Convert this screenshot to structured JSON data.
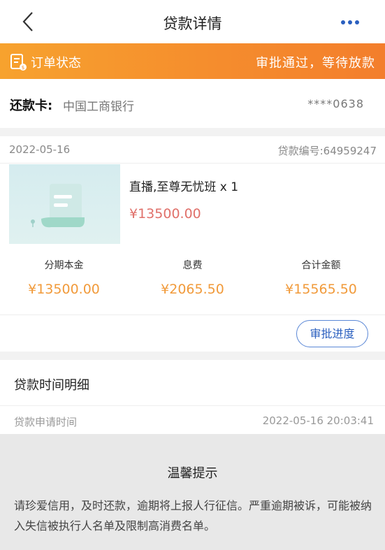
{
  "nav": {
    "title": "贷款详情",
    "back_icon": "chevron-left-icon",
    "more_icon": "more-dots-icon"
  },
  "status": {
    "label": "订单状态",
    "value": "审批通过，等待放款",
    "icon": "document-icon"
  },
  "repay_card": {
    "label": "还款卡:",
    "bank": "中国工商银行",
    "number": "****0638"
  },
  "order": {
    "date": "2022-05-16",
    "loan_no": "贷款编号:64959247",
    "product_name": "直播,至尊无忧班 x 1",
    "product_price": "¥13500.00",
    "summary": [
      {
        "label": "分期本金",
        "value": "¥13500.00"
      },
      {
        "label": "息费",
        "value": "¥2065.50"
      },
      {
        "label": "合计金额",
        "value": "¥15565.50"
      }
    ],
    "approve_button": "审批进度"
  },
  "loan_time": {
    "title": "贷款时间明细",
    "apply_label": "贷款申请时间",
    "apply_time": "2022-05-16 20:03:41"
  },
  "tip": {
    "title": "温馨提示",
    "body": "请珍爱信用，及时还款，逾期将上报人行征信。严重逾期被诉，可能被纳入失信被执行人名单及限制高消费名单。"
  },
  "colors": {
    "status_bar": "#f58d2d",
    "accent_blue": "#2a5fbf",
    "amount_orange": "#f19a3a",
    "price_red": "#e0706a"
  }
}
